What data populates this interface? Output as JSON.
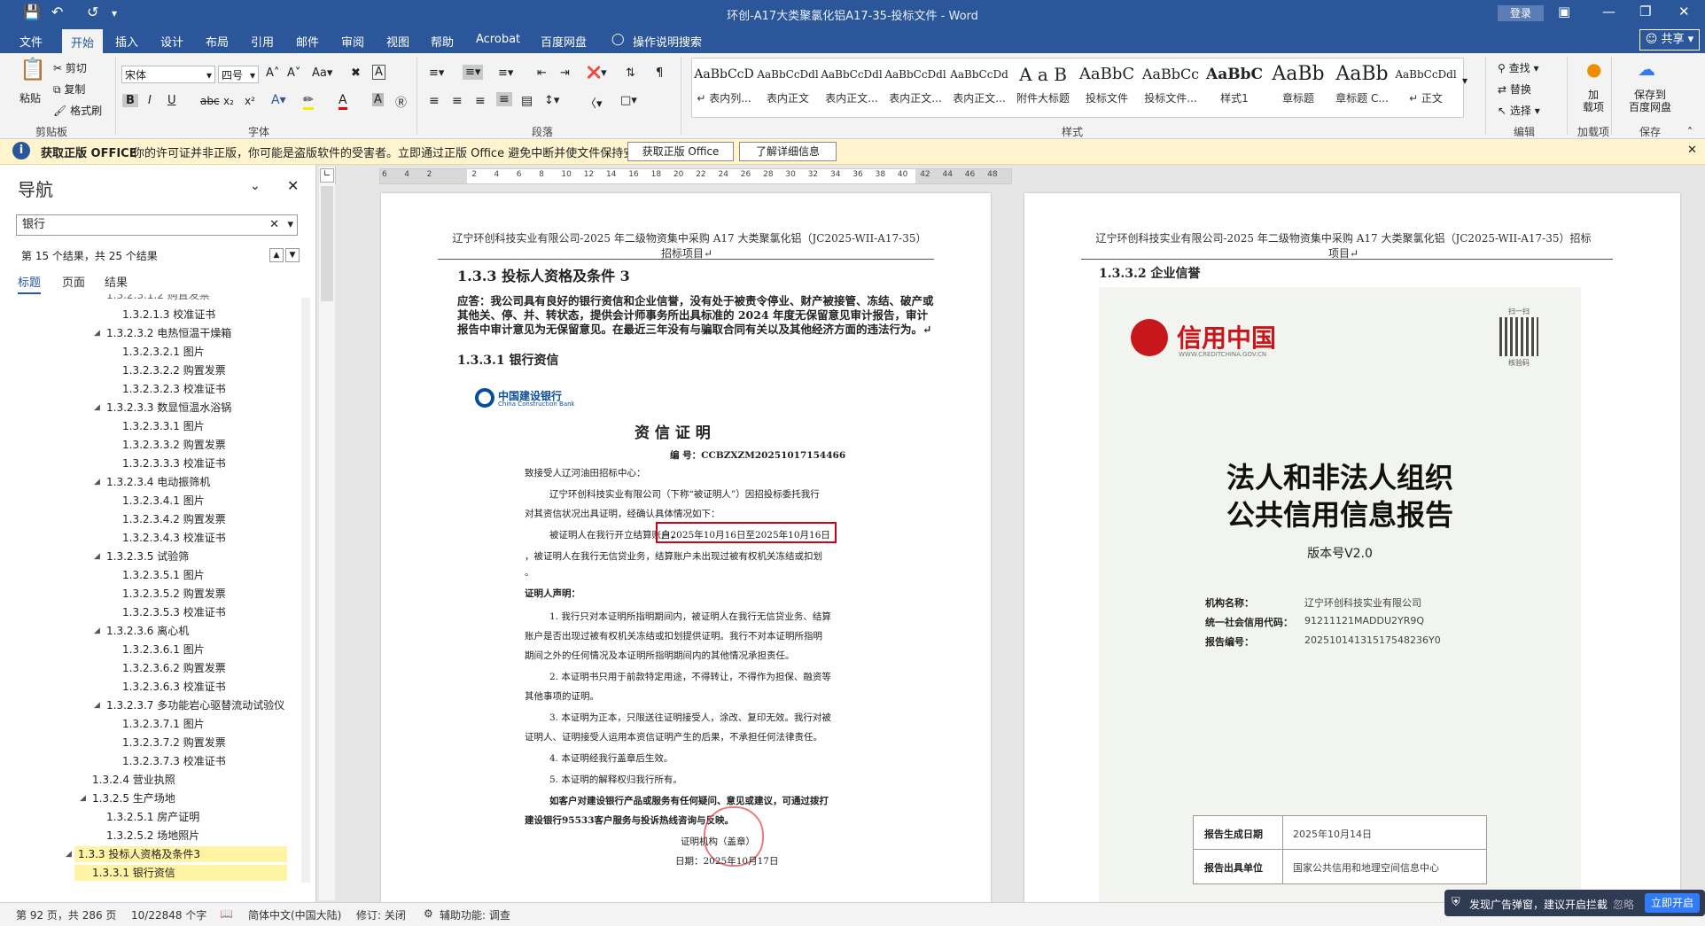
{
  "window": {
    "title": "环创-A17大类聚氯化铝A17-35-投标文件  -  Word",
    "login_label": "登录",
    "minimize": "—",
    "restore": "❐",
    "close": "✕"
  },
  "tabs": [
    "文件",
    "开始",
    "插入",
    "设计",
    "布局",
    "引用",
    "邮件",
    "审阅",
    "视图",
    "帮助",
    "Acrobat",
    "百度网盘"
  ],
  "tab_search": "操作说明搜索",
  "share_label": "共享",
  "ribbon": {
    "clipboard": {
      "paste": "粘贴",
      "cut": "剪切",
      "copy": "复制",
      "format_painter": "格式刷",
      "label": "剪贴板"
    },
    "font": {
      "font_name": "宋体",
      "font_size": "四号",
      "label": "字体"
    },
    "paragraph_label": "段落",
    "styles_label": "样式",
    "styles": [
      {
        "preview": "AaBbCcD",
        "name": "↵ 表内列..."
      },
      {
        "preview": "AaBbCcDdl",
        "name": "表内正文"
      },
      {
        "preview": "AaBbCcDdl",
        "name": "表内正文..."
      },
      {
        "preview": "AaBbCcDdl",
        "name": "表内正文..."
      },
      {
        "preview": "AaBbCcDd",
        "name": "表内正文..."
      },
      {
        "preview": "A a B",
        "name": "附件大标题"
      },
      {
        "preview": "AaBbC",
        "name": "投标文件"
      },
      {
        "preview": "AaBbCc",
        "name": "投标文件..."
      },
      {
        "preview": "AaBbC",
        "name": "样式1"
      },
      {
        "preview": "AaBb",
        "name": "章标题"
      },
      {
        "preview": "AaBb",
        "name": "章标题 C..."
      },
      {
        "preview": "AaBbCcDdl",
        "name": "↵ 正文"
      }
    ],
    "editing": {
      "find": "查找",
      "replace": "替换",
      "select": "选择",
      "label": "编辑"
    },
    "addins": {
      "label": "加载项",
      "btn": "加\n载项"
    },
    "save": {
      "btn": "保存到\n百度网盘",
      "label": "保存"
    }
  },
  "infobar": {
    "title": "获取正版 OFFICE",
    "message": "你的许可证并非正版，你可能是盗版软件的受害者。立即通过正版 Office 避免中断并使文件保持安全。",
    "btn_genuine": "获取正版 Office",
    "btn_learn": "了解详细信息"
  },
  "nav": {
    "title": "导航",
    "search_value": "银行",
    "result_text": "第 15 个结果，共 25 个结果",
    "tabs": [
      "标题",
      "页面",
      "结果"
    ],
    "items": [
      {
        "text": "1.3.2.1.3 校准证书",
        "level": 4
      },
      {
        "text": "1.3.2.3.2 电热恒温干燥箱",
        "level": 3,
        "expanded": true
      },
      {
        "text": "1.3.2.3.2.1 图片",
        "level": 4
      },
      {
        "text": "1.3.2.3.2.2 购置发票",
        "level": 4
      },
      {
        "text": "1.3.2.3.2.3 校准证书",
        "level": 4
      },
      {
        "text": "1.3.2.3.3 数显恒温水浴锅",
        "level": 3,
        "expanded": true
      },
      {
        "text": "1.3.2.3.3.1 图片",
        "level": 4
      },
      {
        "text": "1.3.2.3.3.2 购置发票",
        "level": 4
      },
      {
        "text": "1.3.2.3.3.3 校准证书",
        "level": 4
      },
      {
        "text": "1.3.2.3.4 电动振筛机",
        "level": 3,
        "expanded": true
      },
      {
        "text": "1.3.2.3.4.1 图片",
        "level": 4
      },
      {
        "text": "1.3.2.3.4.2 购置发票",
        "level": 4
      },
      {
        "text": "1.3.2.3.4.3 校准证书",
        "level": 4
      },
      {
        "text": "1.3.2.3.5 试验筛",
        "level": 3,
        "expanded": true
      },
      {
        "text": "1.3.2.3.5.1 图片",
        "level": 4
      },
      {
        "text": "1.3.2.3.5.2 购置发票",
        "level": 4
      },
      {
        "text": "1.3.2.3.5.3 校准证书",
        "level": 4
      },
      {
        "text": "1.3.2.3.6 离心机",
        "level": 3,
        "expanded": true
      },
      {
        "text": "1.3.2.3.6.1 图片",
        "level": 4
      },
      {
        "text": "1.3.2.3.6.2 购置发票",
        "level": 4
      },
      {
        "text": "1.3.2.3.6.3 校准证书",
        "level": 4
      },
      {
        "text": "1.3.2.3.7 多功能岩心驱替流动试验仪",
        "level": 3,
        "expanded": true
      },
      {
        "text": "1.3.2.3.7.1 图片",
        "level": 4
      },
      {
        "text": "1.3.2.3.7.2 购置发票",
        "level": 4
      },
      {
        "text": "1.3.2.3.7.3 校准证书",
        "level": 4
      },
      {
        "text": "1.3.2.4 营业执照",
        "level": 2
      },
      {
        "text": "1.3.2.5 生产场地",
        "level": 2,
        "expanded": true
      },
      {
        "text": "1.3.2.5.1 房产证明",
        "level": 3
      },
      {
        "text": "1.3.2.5.2 场地照片",
        "level": 3
      },
      {
        "text": "1.3.3 投标人资格及条件3",
        "level": 1,
        "expanded": true,
        "highlight": true
      },
      {
        "text": "1.3.3.1 银行资信",
        "level": 2,
        "highlight": true
      }
    ]
  },
  "ruler_numbers": [
    "6",
    "4",
    "2",
    "",
    "2",
    "4",
    "6",
    "8",
    "10",
    "12",
    "14",
    "16",
    "18",
    "20",
    "22",
    "24",
    "26",
    "28",
    "30",
    "32",
    "34",
    "36",
    "38",
    "40",
    "42",
    "44",
    "46",
    "48"
  ],
  "page1": {
    "header": "辽宁环创科技实业有限公司-2025 年二级物资集中采购 A17 大类聚氯化铝（JC2025-WII-A17-35）招标项目↵",
    "heading": "1.3.3  投标人资格及条件 3",
    "answer": "应答：我公司具有良好的银行资信和企业信誉，没有处于被责令停业、财产被接管、冻结、破产或其他关、停、并、转状态，提供会计师事务所出具标准的 2024 年度无保留意见审计报告，审计报告中审计意见为无保留意见。在最近三年没有与骗取合同有关以及其他经济方面的违法行为。↵",
    "subheading": "1.3.3.1  银行资信",
    "cert": {
      "bank": "中国建设银行",
      "bank_en": "China Construction Bank",
      "title": "资 信 证 明",
      "number": "编 号：CCBZXZM20251017154466",
      "to": "致接受人辽河油田招标中心：",
      "p1a": "辽宁环创科技实业有限公司（下称“被证明人”）因招投标委托我行",
      "p1b": "对其资信状况出具证明，经确认具体情况如下：",
      "p2a": "被证明人在我行开立结算账户，",
      "p2b": "自2025年10月16日至2025年10月16日",
      "p2c": "，被证明人在我行无信贷业务，结算账户未出现过被有权机关冻结或扣划",
      "p2d": "。",
      "decl": "证明人声明：",
      "d1a": "1. 我行只对本证明所指明期间内，被证明人在我行无信贷业务、结算",
      "d1b": "账户是否出现过被有权机关冻结或扣划提供证明。我行不对本证明所指明",
      "d1c": "期间之外的任何情况及本证明所指明期间内的其他情况承担责任。",
      "d2a": "2. 本证明书只用于前款特定用途，不得转让，不得作为担保、融资等",
      "d2b": "其他事项的证明。",
      "d3a": "3. 本证明为正本，只限送往证明接受人，涂改、复印无效。我行对被",
      "d3b": "证明人、证明接受人运用本资信证明产生的后果，不承担任何法律责任。",
      "d4": "4. 本证明经我行盖章后生效。",
      "d5": "5. 本证明的解释权归我行所有。",
      "f1": "如客户对建设银行产品或服务有任何疑问、意见或建议，可通过拨打",
      "f2": "建设银行95533客户服务与投诉热线咨询与反映。",
      "sign": "证明机构（盖章）",
      "date": "日期：2025年10月17日"
    }
  },
  "page2": {
    "header": "辽宁环创科技实业有限公司-2025 年二级物资集中采购 A17 大类聚氯化铝（JC2025-WII-A17-35）招标项目↵",
    "subheading": "1.3.3.2  企业信誉",
    "credit": {
      "logo": "信用中国",
      "site": "WWW.CREDITCHINA.GOV.CN",
      "scan": "扫一扫",
      "qr_label": "核验码",
      "title1": "法人和非法人组织",
      "title2": "公共信用信息报告",
      "version": "版本号V2.0",
      "org_label": "机构名称：",
      "org_value": "辽宁环创科技实业有限公司",
      "code_label": "统一社会信用代码：",
      "code_value": "91211121MADDU2YR9Q",
      "report_label": "报告编号：",
      "report_value": "20251014131517548236Y0",
      "gen_date_label": "报告生成日期",
      "gen_date_value": "2025年10月14日",
      "issuer_label": "报告出具单位",
      "issuer_value": "国家公共信用和地理空间信息中心"
    }
  },
  "status": {
    "page": "第 92 页，共 286 页",
    "words": "10/22848 个字",
    "lang": "简体中文(中国大陆)",
    "track": "修订: 关闭",
    "access": "辅助功能: 调查"
  },
  "ad": {
    "text": "发现广告弹窗，建议开启拦截",
    "ignore": "忽略",
    "enable": "立即开启"
  },
  "colors": {
    "brand": "#2b579a",
    "highlight": "#fff4a3",
    "red_box": "#d0021b",
    "credit_red": "#c8161d"
  }
}
